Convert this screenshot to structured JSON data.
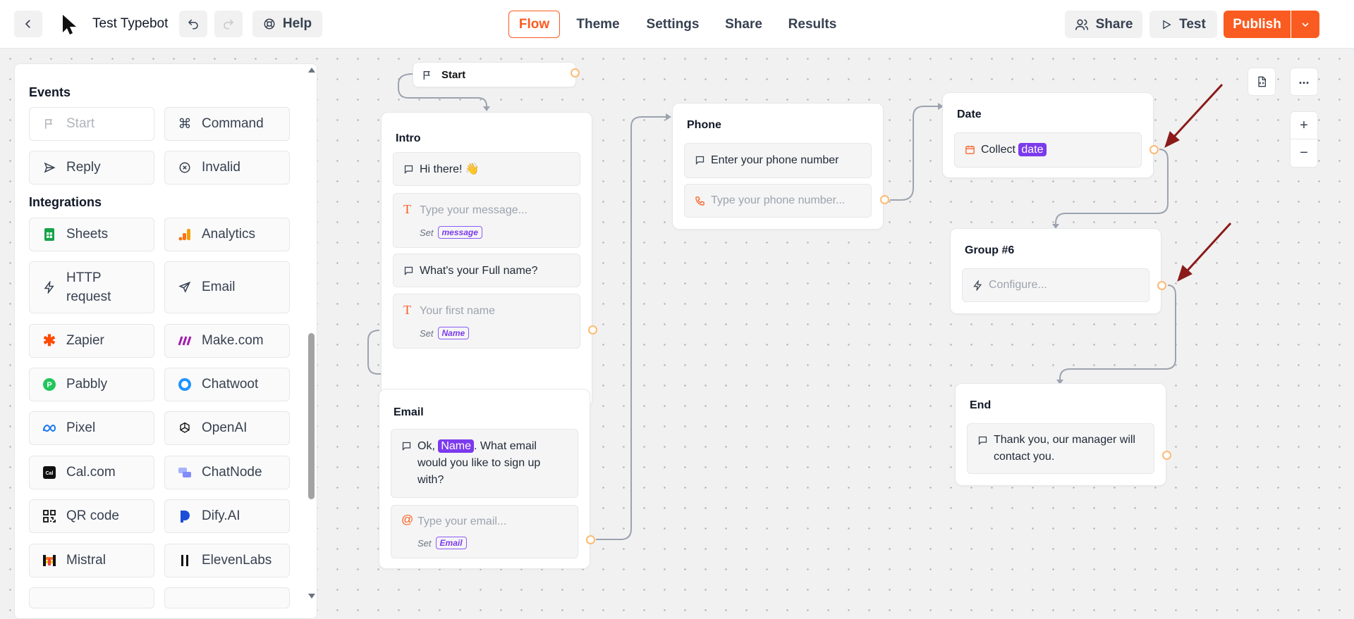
{
  "header": {
    "back_icon": "chevron-left-icon",
    "bot_icon": "cursor-arrow-icon",
    "bot_name": "Test Typebot",
    "help_label": "Help",
    "tabs": [
      "Flow",
      "Theme",
      "Settings",
      "Share",
      "Results"
    ],
    "active_tab": "Flow",
    "share_label": "Share",
    "test_label": "Test",
    "publish_label": "Publish",
    "accent": "#fa5b20"
  },
  "sidebar": {
    "events_title": "Events",
    "events": [
      {
        "label": "Start",
        "icon": "flag-icon",
        "disabled": true
      },
      {
        "label": "Command",
        "icon": "command-icon"
      },
      {
        "label": "Reply",
        "icon": "send-icon"
      },
      {
        "label": "Invalid",
        "icon": "x-circle-icon"
      }
    ],
    "integrations_title": "Integrations",
    "integrations": [
      {
        "label": "Sheets",
        "icon": "sheets-icon"
      },
      {
        "label": "Analytics",
        "icon": "analytics-icon"
      },
      {
        "label": "HTTP request",
        "icon": "bolt-icon"
      },
      {
        "label": "Email",
        "icon": "send-icon"
      },
      {
        "label": "Zapier",
        "icon": "zapier-icon"
      },
      {
        "label": "Make.com",
        "icon": "make-icon"
      },
      {
        "label": "Pabbly",
        "icon": "pabbly-icon"
      },
      {
        "label": "Chatwoot",
        "icon": "chatwoot-icon"
      },
      {
        "label": "Pixel",
        "icon": "meta-icon"
      },
      {
        "label": "OpenAI",
        "icon": "openai-icon"
      },
      {
        "label": "Cal.com",
        "icon": "calcom-icon"
      },
      {
        "label": "ChatNode",
        "icon": "chatnode-icon"
      },
      {
        "label": "QR code",
        "icon": "qr-icon"
      },
      {
        "label": "Dify.AI",
        "icon": "dify-icon"
      },
      {
        "label": "Mistral",
        "icon": "mistral-icon"
      },
      {
        "label": "ElevenLabs",
        "icon": "elevenlabs-icon"
      }
    ]
  },
  "flow": {
    "start": {
      "label": "Start"
    },
    "intro": {
      "title": "Intro",
      "blocks": [
        {
          "text": "Hi there! 👋"
        },
        {
          "placeholder": "Type your message...",
          "set_label": "Set",
          "var": "message"
        },
        {
          "text": "What's your Full name?"
        },
        {
          "placeholder": "Your first name",
          "set_label": "Set",
          "var": "Name"
        }
      ]
    },
    "email": {
      "title": "Email",
      "msg_before": "Ok, ",
      "msg_var": "Name",
      "msg_after": ". What email would you like to sign up with?",
      "input_placeholder": "Type your email...",
      "set_label": "Set",
      "var": "Email"
    },
    "phone": {
      "title": "Phone",
      "text": "Enter your phone number",
      "input_placeholder": "Type your phone number..."
    },
    "date": {
      "title": "Date",
      "text": "Collect",
      "var": "date"
    },
    "group6": {
      "title": "Group #6",
      "placeholder": "Configure..."
    },
    "end": {
      "title": "End",
      "text": "Thank you, our manager will contact you."
    }
  },
  "controls": {
    "zoom_in": "+",
    "zoom_out": "−"
  }
}
